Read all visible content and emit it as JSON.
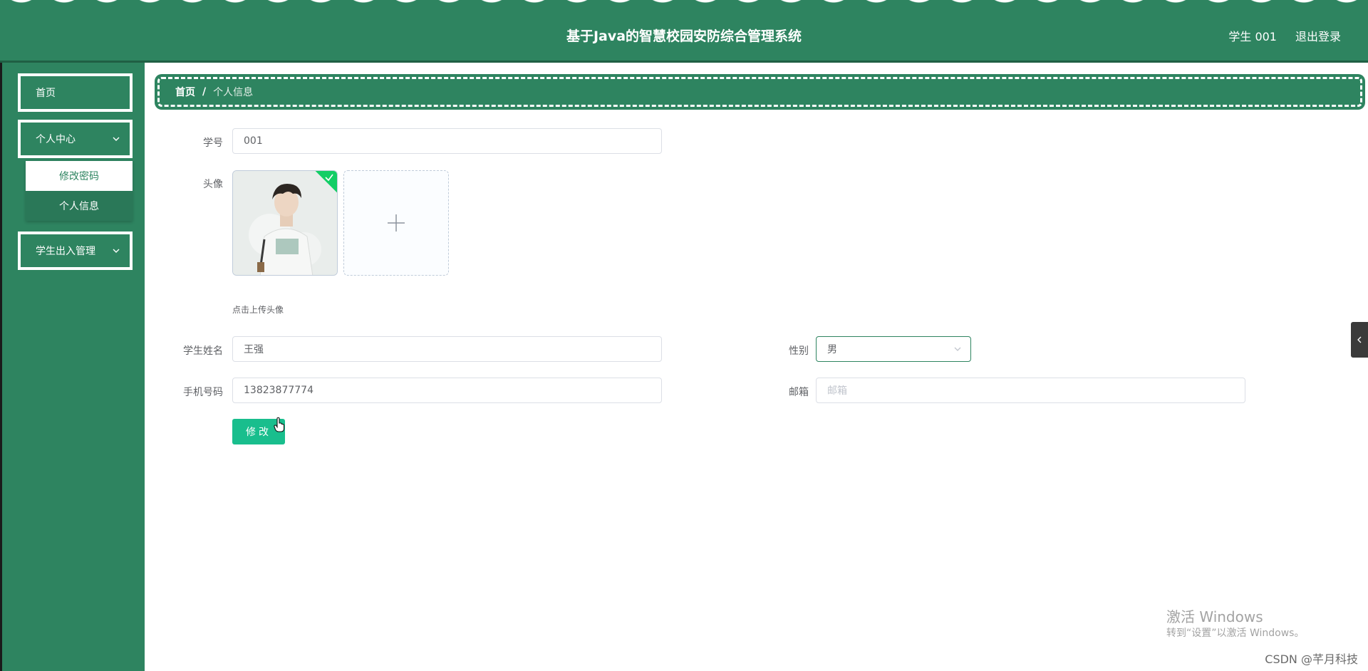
{
  "header": {
    "title": "基于Java的智慧校园安防综合管理系统",
    "user": "学生 001",
    "logout": "退出登录"
  },
  "sidebar": {
    "home": "首页",
    "personal_center": "个人中心",
    "submenu": [
      "修改密码",
      "个人信息"
    ],
    "student_access": "学生出入管理"
  },
  "breadcrumb": {
    "home": "首页",
    "separator": "/",
    "current": "个人信息"
  },
  "form": {
    "student_id_label": "学号",
    "student_id_value": "001",
    "avatar_label": "头像",
    "upload_tip": "点击上传头像",
    "name_label": "学生姓名",
    "name_value": "王强",
    "gender_label": "性别",
    "gender_value": "男",
    "phone_label": "手机号码",
    "phone_value": "13823877774",
    "email_label": "邮箱",
    "email_placeholder": "邮箱",
    "submit_label": "修改"
  },
  "watermark": {
    "line1": "激活 Windows",
    "line2": "转到“设置”以激活 Windows。",
    "csdn": "CSDN @芊月科技"
  },
  "colors": {
    "primary_green": "#2e8460",
    "button_green": "#19be8d"
  }
}
